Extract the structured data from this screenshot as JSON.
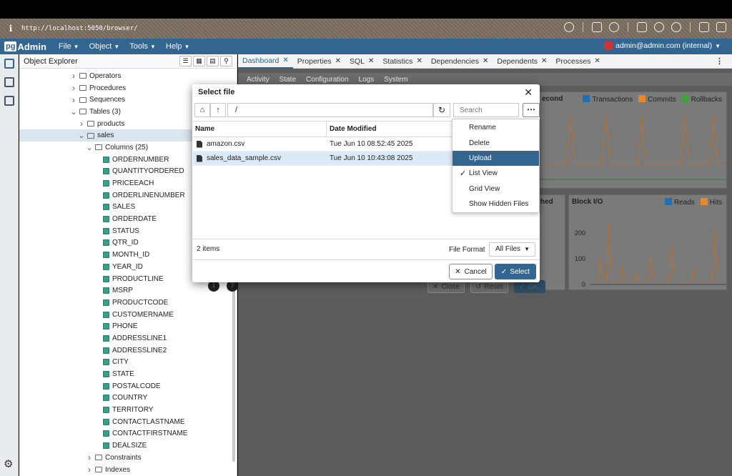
{
  "browser": {
    "url": "http://localhost:5050/browser/"
  },
  "app": {
    "logo_pg": "pg",
    "logo_admin": "Admin",
    "menu": [
      "File",
      "Object",
      "Tools",
      "Help"
    ],
    "user": "admin@admin.com (internal)"
  },
  "explorer": {
    "title": "Object Explorer",
    "tree": [
      {
        "label": "Operators",
        "indent": 3,
        "caret": ">"
      },
      {
        "label": "Procedures",
        "indent": 3,
        "caret": ">"
      },
      {
        "label": "Sequences",
        "indent": 3,
        "caret": ">"
      },
      {
        "label": "Tables (3)",
        "indent": 3,
        "caret": "v"
      },
      {
        "label": "products",
        "indent": 4,
        "caret": ">"
      },
      {
        "label": "sales",
        "indent": 4,
        "caret": "v",
        "selected": true
      },
      {
        "label": "Columns (25)",
        "indent": 5,
        "caret": "v"
      },
      {
        "label": "ORDERNUMBER",
        "indent": 6,
        "col": true
      },
      {
        "label": "QUANTITYORDERED",
        "indent": 6,
        "col": true
      },
      {
        "label": "PRICEEACH",
        "indent": 6,
        "col": true
      },
      {
        "label": "ORDERLINENUMBER",
        "indent": 6,
        "col": true
      },
      {
        "label": "SALES",
        "indent": 6,
        "col": true
      },
      {
        "label": "ORDERDATE",
        "indent": 6,
        "col": true
      },
      {
        "label": "STATUS",
        "indent": 6,
        "col": true
      },
      {
        "label": "QTR_ID",
        "indent": 6,
        "col": true
      },
      {
        "label": "MONTH_ID",
        "indent": 6,
        "col": true
      },
      {
        "label": "YEAR_ID",
        "indent": 6,
        "col": true
      },
      {
        "label": "PRODUCTLINE",
        "indent": 6,
        "col": true
      },
      {
        "label": "MSRP",
        "indent": 6,
        "col": true
      },
      {
        "label": "PRODUCTCODE",
        "indent": 6,
        "col": true
      },
      {
        "label": "CUSTOMERNAME",
        "indent": 6,
        "col": true
      },
      {
        "label": "PHONE",
        "indent": 6,
        "col": true
      },
      {
        "label": "ADDRESSLINE1",
        "indent": 6,
        "col": true
      },
      {
        "label": "ADDRESSLINE2",
        "indent": 6,
        "col": true
      },
      {
        "label": "CITY",
        "indent": 6,
        "col": true
      },
      {
        "label": "STATE",
        "indent": 6,
        "col": true
      },
      {
        "label": "POSTALCODE",
        "indent": 6,
        "col": true
      },
      {
        "label": "COUNTRY",
        "indent": 6,
        "col": true
      },
      {
        "label": "TERRITORY",
        "indent": 6,
        "col": true
      },
      {
        "label": "CONTACTLASTNAME",
        "indent": 6,
        "col": true
      },
      {
        "label": "CONTACTFIRSTNAME",
        "indent": 6,
        "col": true
      },
      {
        "label": "DEALSIZE",
        "indent": 6,
        "col": true
      },
      {
        "label": "Constraints",
        "indent": 5,
        "caret": ">"
      },
      {
        "label": "Indexes",
        "indent": 5,
        "caret": ">"
      }
    ]
  },
  "tabs": [
    "Dashboard",
    "Properties",
    "SQL",
    "Statistics",
    "Dependencies",
    "Dependents",
    "Processes"
  ],
  "subtabs": [
    "Activity",
    "State",
    "Configuration",
    "Logs",
    "System"
  ],
  "charts": {
    "top_title_fragment": "econd",
    "top_legend": [
      {
        "name": "Transactions",
        "color": "#1f6fb5"
      },
      {
        "name": "Commits",
        "color": "#e8882a"
      },
      {
        "name": "Rollbacks",
        "color": "#3aa535"
      }
    ],
    "mid_left_fragment": "hed",
    "block_io_title": "Block I/O",
    "block_io_legend": [
      {
        "name": "Reads",
        "color": "#1f6fb5"
      },
      {
        "name": "Hits",
        "color": "#e8882a"
      }
    ],
    "block_io_ticks": [
      "200",
      "100",
      "0"
    ]
  },
  "underlying_dialog": {
    "close": "Close",
    "reset": "Reset",
    "ok": "OK"
  },
  "modal": {
    "title": "Select file",
    "path": "/",
    "search_placeholder": "Search",
    "columns": [
      "Name",
      "Date Modified"
    ],
    "files": [
      {
        "name": "amazon.csv",
        "modified": "Tue Jun 10 08:52:45 2025",
        "selected": false
      },
      {
        "name": "sales_data_sample.csv",
        "modified": "Tue Jun 10 10:43:08 2025",
        "selected": true
      }
    ],
    "items_count": "2 items",
    "file_format_label": "File Format",
    "file_format_value": "All Files",
    "cancel_label": "Cancel",
    "select_label": "Select"
  },
  "dropdown": [
    {
      "label": "Rename"
    },
    {
      "label": "Delete"
    },
    {
      "label": "Upload",
      "highlighted": true
    },
    {
      "label": "List View",
      "checked": true
    },
    {
      "label": "Grid View"
    },
    {
      "label": "Show Hidden Files"
    }
  ]
}
